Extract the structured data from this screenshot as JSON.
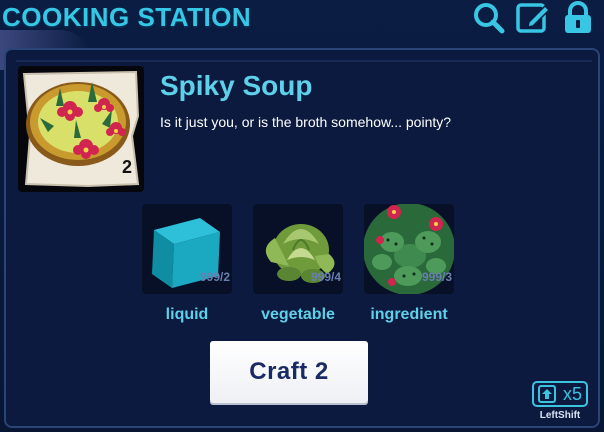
{
  "header": {
    "title": "COOKING STATION",
    "icons": [
      "search-icon",
      "edit-icon",
      "lock-icon"
    ]
  },
  "item": {
    "name": "Spiky Soup",
    "description": "Is it just you, or is the broth somehow... pointy?",
    "count": "2"
  },
  "ingredients": [
    {
      "label": "liquid",
      "qty": "999/2",
      "icon": "cube-icon"
    },
    {
      "label": "vegetable",
      "qty": "999/4",
      "icon": "cabbage-icon"
    },
    {
      "label": "ingredient",
      "qty": "999/3",
      "icon": "cactus-icon"
    }
  ],
  "craft": {
    "label": "Craft 2"
  },
  "shift": {
    "multiplier": "x5",
    "label": "LeftShift"
  },
  "colors": {
    "accent": "#5fd0ea",
    "background": "#0b1a3e",
    "button_text": "#1a2a66"
  }
}
